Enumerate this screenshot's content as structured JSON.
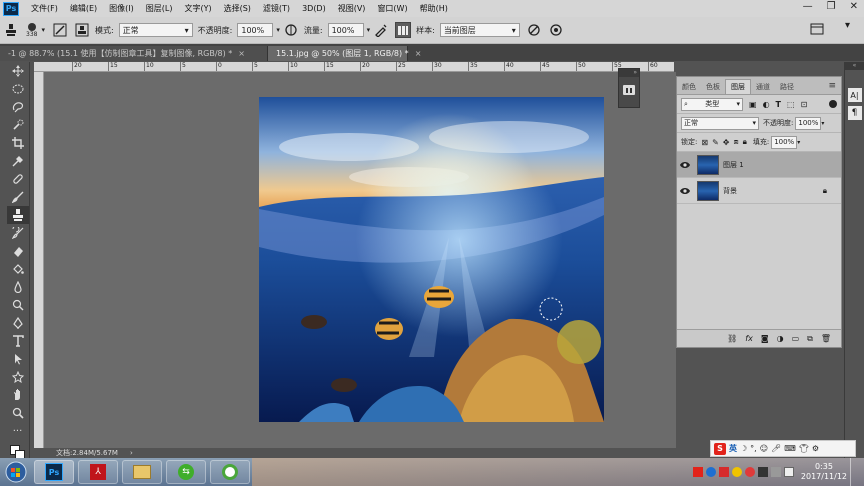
{
  "menubar": {
    "app_logo": "Ps",
    "items": [
      "文件(F)",
      "编辑(E)",
      "图像(I)",
      "图层(L)",
      "文字(Y)",
      "选择(S)",
      "滤镜(T)",
      "3D(D)",
      "视图(V)",
      "窗口(W)",
      "帮助(H)"
    ]
  },
  "options": {
    "brush_size": "338",
    "mode": "正常",
    "opacity_label": "不透明度:",
    "opacity": "100%",
    "flow_label": "流量:",
    "flow": "100%",
    "sample": "当前图层"
  },
  "tabs": [
    {
      "label": "-1 @ 88.7% (15.1 使用【仿制图章工具】复制图像, RGB/8) *",
      "close": "×"
    },
    {
      "label": "15.1.jpg @ 50% (图层 1, RGB/8) *",
      "close": "×"
    }
  ],
  "ruler": {
    "marks": [
      "20",
      "15",
      "10",
      "5",
      "0",
      "5",
      "10",
      "15",
      "20",
      "25",
      "30",
      "35",
      "40",
      "45",
      "50",
      "55",
      "60",
      "65"
    ]
  },
  "status": {
    "doc_size": "文档:2.84M/5.67M"
  },
  "layers_panel": {
    "tabs": [
      "颜色",
      "色板",
      "图层",
      "通道",
      "路径"
    ],
    "kind_label": "类型",
    "blend_mode": "正常",
    "opacity_label": "不透明度:",
    "opacity": "100%",
    "lock_label": "锁定:",
    "fill_label": "填充:",
    "fill": "100%",
    "layers": [
      {
        "name": "图层 1",
        "selected": true
      },
      {
        "name": "背景",
        "selected": false
      }
    ]
  },
  "ime": {
    "label": "英"
  },
  "clock": {
    "time": "0:35",
    "date": "2017/11/12"
  },
  "colors": {
    "accent": "#31a8ff",
    "workspace": "#535353",
    "panel": "#cfcfcf"
  }
}
